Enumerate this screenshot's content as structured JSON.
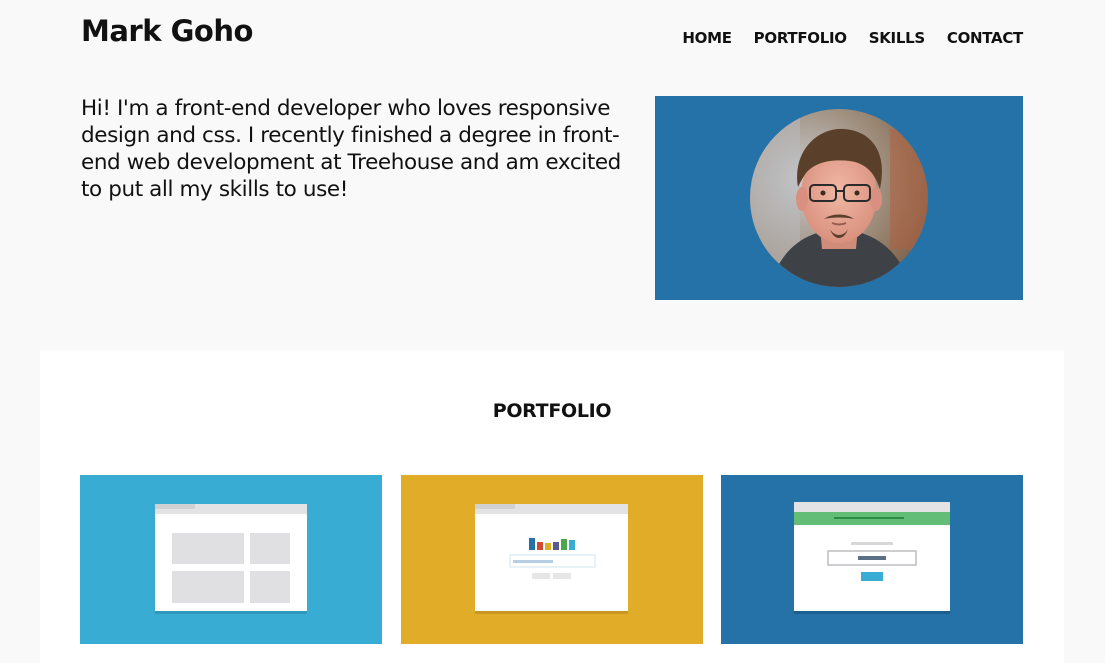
{
  "site": {
    "title": "Mark Goho"
  },
  "nav": {
    "items": [
      {
        "label": "HOME"
      },
      {
        "label": "PORTFOLIO"
      },
      {
        "label": "SKILLS"
      },
      {
        "label": "CONTACT"
      }
    ]
  },
  "intro": {
    "text": "Hi! I'm a front-end developer who loves responsive design and css. I recently finished a degree in front-end web development at Treehouse and am excited to put all my skills to use!"
  },
  "portfolio": {
    "title": "PORTFOLIO",
    "cards": [
      {
        "thumbnail": "layout-grid-mockup",
        "color": "#38acd2"
      },
      {
        "thumbnail": "bar-chart-mockup",
        "color": "#e1ac28"
      },
      {
        "thumbnail": "form-mockup",
        "color": "#2572a9"
      }
    ]
  },
  "colors": {
    "page_bg": "#f9f9f9",
    "photo_bg": "#2572a9"
  }
}
